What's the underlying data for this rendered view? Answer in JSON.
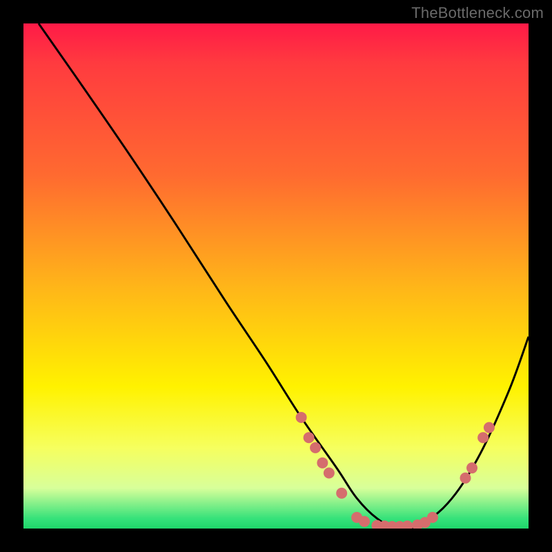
{
  "watermark": "TheBottleneck.com",
  "chart_data": {
    "type": "line",
    "title": "",
    "xlabel": "",
    "ylabel": "",
    "xlim": [
      0,
      100
    ],
    "ylim": [
      0,
      100
    ],
    "series": [
      {
        "name": "curve",
        "x": [
          3,
          10,
          20,
          30,
          40,
          48,
          55,
          62,
          66,
          70,
          74,
          78,
          84,
          90,
          96,
          100
        ],
        "values": [
          100,
          90,
          75.5,
          60.5,
          45,
          33,
          22,
          12,
          6,
          2,
          0,
          0.5,
          5,
          14,
          27,
          38
        ]
      }
    ],
    "scatter_points": {
      "name": "markers",
      "color": "#d56d6d",
      "points": [
        {
          "x": 55,
          "y": 22
        },
        {
          "x": 56.5,
          "y": 18
        },
        {
          "x": 57.8,
          "y": 16
        },
        {
          "x": 59.2,
          "y": 13
        },
        {
          "x": 60.5,
          "y": 11
        },
        {
          "x": 63.0,
          "y": 7
        },
        {
          "x": 66.0,
          "y": 2.2
        },
        {
          "x": 67.5,
          "y": 1.4
        },
        {
          "x": 70.0,
          "y": 0.6
        },
        {
          "x": 71.5,
          "y": 0.5
        },
        {
          "x": 73.0,
          "y": 0.4
        },
        {
          "x": 74.5,
          "y": 0.4
        },
        {
          "x": 76.0,
          "y": 0.5
        },
        {
          "x": 78.0,
          "y": 0.7
        },
        {
          "x": 79.5,
          "y": 1.2
        },
        {
          "x": 81.0,
          "y": 2.2
        },
        {
          "x": 87.5,
          "y": 10
        },
        {
          "x": 88.8,
          "y": 12
        },
        {
          "x": 91.0,
          "y": 18
        },
        {
          "x": 92.2,
          "y": 20
        }
      ]
    },
    "background_gradient": {
      "top": "#ff1a47",
      "mid": "#fff200",
      "bottom": "#1fd56b"
    }
  }
}
